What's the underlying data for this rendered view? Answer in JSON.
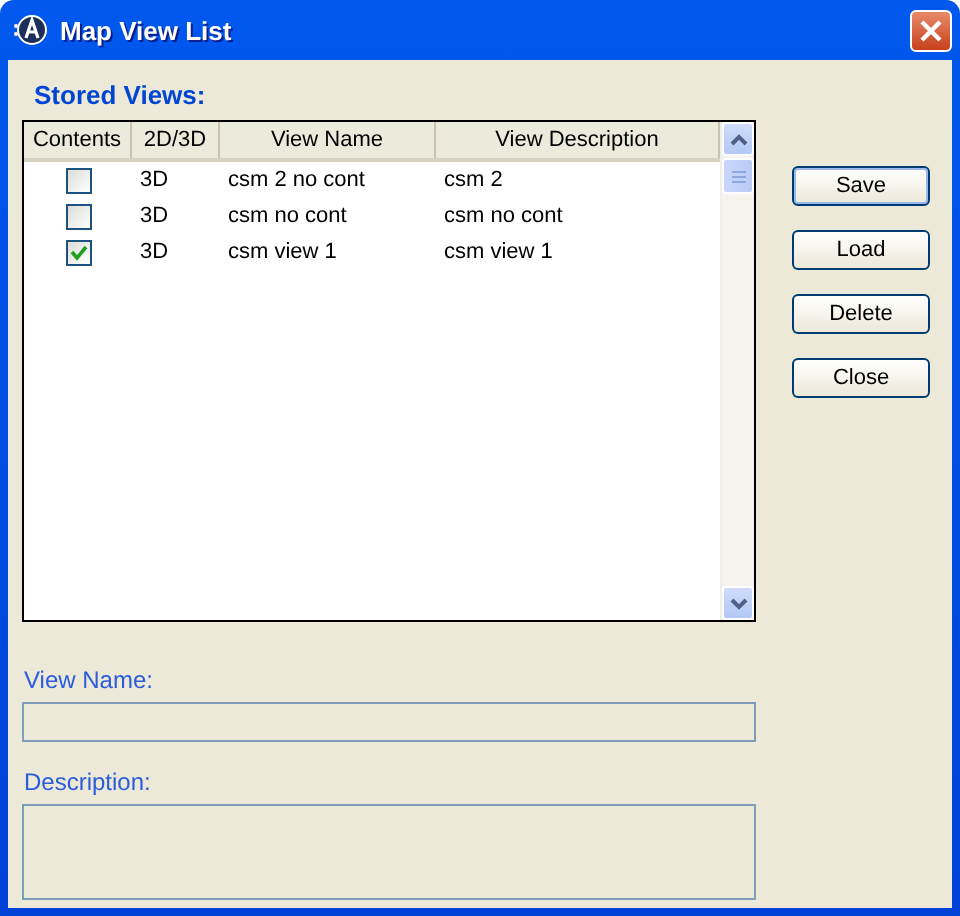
{
  "window": {
    "title": "Map View List"
  },
  "stored_views": {
    "label": "Stored Views:",
    "columns": [
      "Contents",
      "2D/3D",
      "View Name",
      "View Description"
    ],
    "rows": [
      {
        "checked": false,
        "mode": "3D",
        "name": "csm 2 no cont",
        "description": "csm 2"
      },
      {
        "checked": false,
        "mode": "3D",
        "name": "csm no cont",
        "description": "csm no cont"
      },
      {
        "checked": true,
        "mode": "3D",
        "name": "csm view 1",
        "description": "csm view 1"
      }
    ]
  },
  "buttons": [
    {
      "label": "Save",
      "default": true
    },
    {
      "label": "Load",
      "default": false
    },
    {
      "label": "Delete",
      "default": false
    },
    {
      "label": "Close",
      "default": false
    }
  ],
  "view_name": {
    "label": "View Name:"
  },
  "description": {
    "label": "Description:"
  }
}
